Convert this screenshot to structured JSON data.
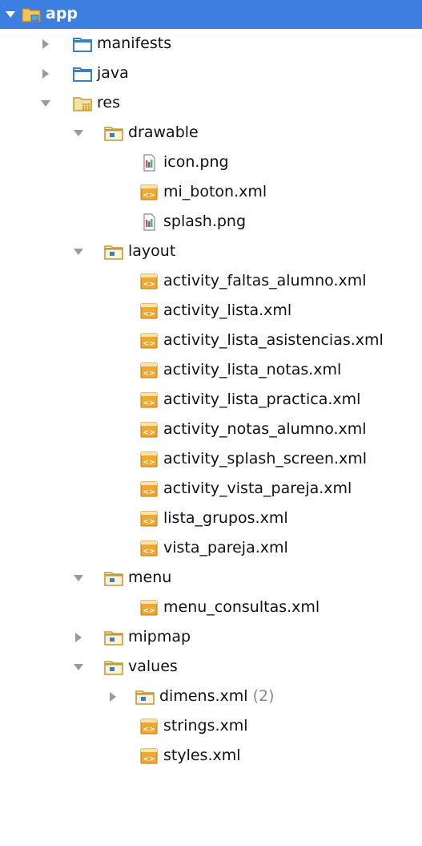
{
  "tree": {
    "root": {
      "label": "app"
    },
    "manifests": {
      "label": "manifests"
    },
    "java": {
      "label": "java"
    },
    "res": {
      "label": "res",
      "drawable": {
        "label": "drawable",
        "files": [
          "icon.png",
          "mi_boton.xml",
          "splash.png"
        ]
      },
      "layout": {
        "label": "layout",
        "files": [
          "activity_faltas_alumno.xml",
          "activity_lista.xml",
          "activity_lista_asistencias.xml",
          "activity_lista_notas.xml",
          "activity_lista_practica.xml",
          "activity_notas_alumno.xml",
          "activity_splash_screen.xml",
          "activity_vista_pareja.xml",
          "lista_grupos.xml",
          "vista_pareja.xml"
        ]
      },
      "menu": {
        "label": "menu",
        "files": [
          "menu_consultas.xml"
        ]
      },
      "mipmap": {
        "label": "mipmap"
      },
      "values": {
        "label": "values",
        "dimens": {
          "label": "dimens.xml",
          "count": "(2)"
        },
        "files": [
          "strings.xml",
          "styles.xml"
        ]
      }
    }
  },
  "colors": {
    "selection": "#3d7ee1",
    "folder_brown": "#c49a3b",
    "folder_blue": "#3b7fc4",
    "muted": "#8a8a8a"
  },
  "icons": {
    "expanded": "triangle-down-icon",
    "collapsed": "triangle-right-icon",
    "module": "module-folder-icon",
    "source_folder": "source-folder-icon",
    "res_folder": "resources-folder-icon",
    "res_subfolder": "resource-subfolder-icon",
    "png_file": "image-file-icon",
    "xml_file": "xml-file-icon"
  }
}
